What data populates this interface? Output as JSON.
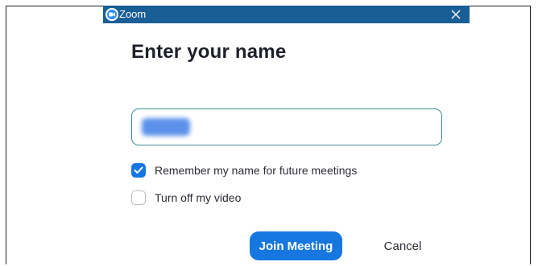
{
  "window": {
    "title": "Zoom",
    "close_icon": "close-icon",
    "app_icon": "zoom-logo-icon"
  },
  "dialog": {
    "heading": "Enter your name",
    "name_input": {
      "value": "",
      "value_obscured": true
    },
    "options": [
      {
        "label": "Remember my name for future meetings",
        "checked": true
      },
      {
        "label": "Turn off my video",
        "checked": false
      }
    ],
    "join_label": "Join Meeting",
    "cancel_label": "Cancel"
  },
  "colors": {
    "titlebar": "#1a5e96",
    "accent": "#1677e0",
    "input_border": "#3b8d97",
    "heading": "#1d1f2a"
  }
}
